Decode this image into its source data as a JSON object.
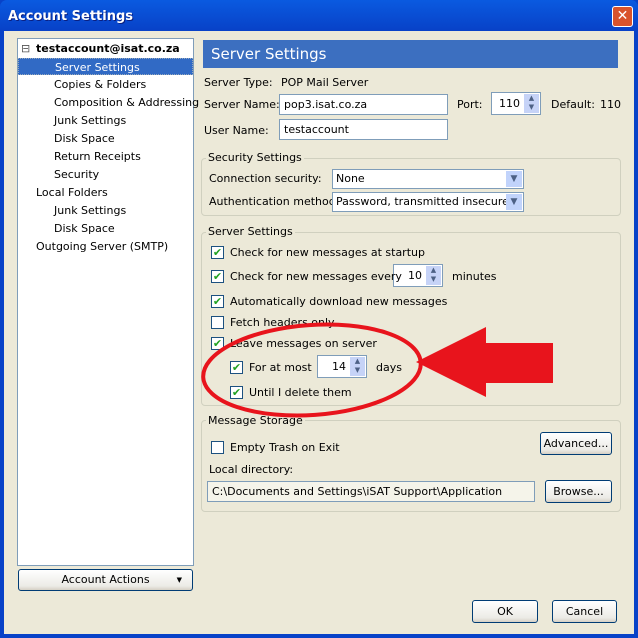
{
  "window": {
    "title": "Account Settings",
    "close_icon": "close-icon"
  },
  "tree": {
    "items": [
      {
        "label": "testaccount@isat.co.za",
        "level": 0,
        "expanded": true,
        "bold": true
      },
      {
        "label": "Server Settings",
        "level": 1,
        "selected": true
      },
      {
        "label": "Copies & Folders",
        "level": 1
      },
      {
        "label": "Composition & Addressing",
        "level": 1
      },
      {
        "label": "Junk Settings",
        "level": 1
      },
      {
        "label": "Disk Space",
        "level": 1
      },
      {
        "label": "Return Receipts",
        "level": 1
      },
      {
        "label": "Security",
        "level": 1
      },
      {
        "label": "Local Folders",
        "level": 0,
        "expanded": true
      },
      {
        "label": "Junk Settings",
        "level": 1
      },
      {
        "label": "Disk Space",
        "level": 1
      },
      {
        "label": "Outgoing Server (SMTP)",
        "level": 0
      }
    ]
  },
  "account_actions": "Account Actions",
  "header": "Server Settings",
  "server_type_label": "Server Type:",
  "server_type": "POP Mail Server",
  "server_name_label": "Server Name:",
  "server_name": "pop3.isat.co.za",
  "port_label": "Port:",
  "port": "110",
  "default_label": "Default:",
  "default_port": "110",
  "user_name_label": "User Name:",
  "user_name": "testaccount",
  "security": {
    "legend": "Security Settings",
    "conn_label": "Connection security:",
    "conn_value": "None",
    "auth_label": "Authentication method:",
    "auth_value": "Password, transmitted insecurely"
  },
  "server": {
    "legend": "Server Settings",
    "check_startup": {
      "label": "Check for new messages at startup",
      "checked": true
    },
    "check_every": {
      "label": "Check for new messages every",
      "checked": true,
      "value": "10",
      "unit": "minutes"
    },
    "auto_download": {
      "label": "Automatically download new messages",
      "checked": true
    },
    "fetch_headers": {
      "label": "Fetch headers only",
      "checked": false
    },
    "leave_on_server": {
      "label": "Leave messages on server",
      "checked": true
    },
    "for_at_most": {
      "label": "For at most",
      "checked": true,
      "value": "14",
      "unit": "days"
    },
    "until_delete": {
      "label": "Until I delete them",
      "checked": true
    }
  },
  "storage": {
    "legend": "Message Storage",
    "empty_trash": {
      "label": "Empty Trash on Exit",
      "checked": false
    },
    "advanced": "Advanced...",
    "local_dir_label": "Local directory:",
    "local_dir": "C:\\Documents and Settings\\iSAT Support\\Application Data\\Thunde",
    "browse": "Browse..."
  },
  "ok": "OK",
  "cancel": "Cancel",
  "annotation_color": "#e8141c"
}
